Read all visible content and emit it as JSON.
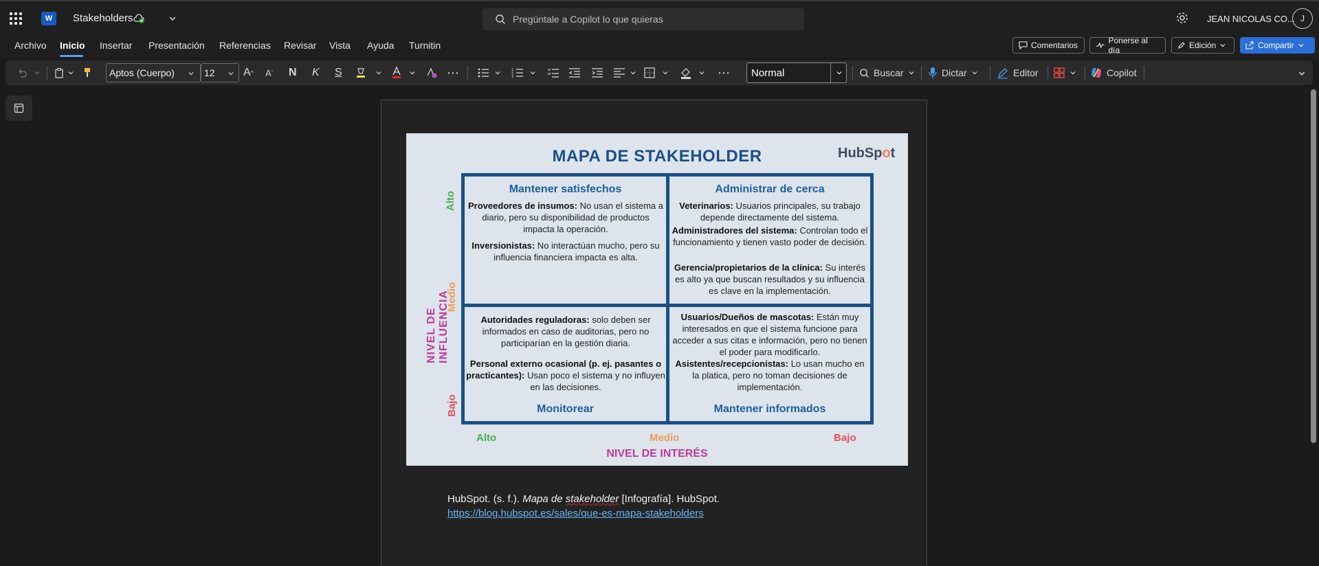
{
  "titlebar": {
    "doc_title": "Stakeholders",
    "search_placeholder": "Pregúntale a Copilot lo que quieras",
    "user_name": "JEAN NICOLAS CO...",
    "avatar_initial": "J",
    "app_badge": "W"
  },
  "menu": {
    "items": [
      "Archivo",
      "Inicio",
      "Insertar",
      "Presentación",
      "Referencias",
      "Revisar",
      "Vista",
      "Ayuda",
      "Turnitin"
    ],
    "active": "Inicio",
    "comments_label": "Comentarios",
    "catchup_label": "Ponerse al día",
    "editing_label": "Edición",
    "share_label": "Compartir"
  },
  "ribbon": {
    "font_name": "Aptos (Cuerpo)",
    "font_size": "12",
    "bold_glyph": "N",
    "italic_glyph": "K",
    "underline_glyph": "S",
    "style_name": "Normal",
    "find_label": "Buscar",
    "dictate_label": "Dictar",
    "editor_label": "Editor",
    "copilot_label": "Copilot"
  },
  "figure": {
    "title": "MAPA DE STAKEHOLDER",
    "brand": "HubSpot",
    "y_axis_label": "NIVEL DE INFLUENCIA",
    "x_axis_label": "NIVEL DE INTERÉS",
    "y_ticks": [
      "Alto",
      "Medio",
      "Bajo"
    ],
    "x_ticks": [
      "Alto",
      "Medio",
      "Bajo"
    ],
    "quadrants": {
      "top_left": {
        "heading": "Mantener satisfechos",
        "entries": [
          {
            "name": "Proveedores de insumos:",
            "text": " No usan el sistema a diario, pero su disponibilidad de productos impacta la operación."
          },
          {
            "name": "Inversionistas:",
            "text": " No interactúan mucho, pero su influencia financiera impacta es alta."
          }
        ]
      },
      "top_right": {
        "heading": "Administrar de cerca",
        "entries": [
          {
            "name": "Veterinarios:",
            "text": " Usuarios principales, su trabajo depende directamente del sistema."
          },
          {
            "name": "Administradores del sistema:",
            "text": " Controlan todo el funcionamiento y tienen vasto poder de decisión."
          },
          {
            "name": "Gerencia/propietarios de la clínica:",
            "text": " Su interés es alto ya que buscan resultados y su influencia es clave en la implementación."
          }
        ]
      },
      "bottom_left": {
        "heading": "Monitorear",
        "entries": [
          {
            "name": "Autoridades reguladoras:",
            "text": " solo deben ser informados en caso de auditorias, pero no participarían en la gestión diaria."
          },
          {
            "name": "Personal externo ocasional (p. ej. pasantes o practicantes):",
            "text": " Usan poco el sistema y no influyen en las decisiones."
          }
        ]
      },
      "bottom_right": {
        "heading": "Mantener informados",
        "entries": [
          {
            "name": "Usuarios/Dueños de mascotas:",
            "text": " Están muy interesados en que el sistema funcione para acceder a sus citas e información, pero no tienen el poder para modificarlo."
          },
          {
            "name": "Asistentes/recepcionistas:",
            "text": " Lo usan mucho en la platica, pero no toman decisiones de implementación."
          }
        ]
      }
    },
    "colors": {
      "navy": "#1c4f86",
      "magenta": "#c0399b",
      "green": "#4caf50",
      "orange": "#f29b57",
      "red": "#e8505b"
    }
  },
  "citation": {
    "prefix": "HubSpot. (s. f.). ",
    "title_part1": "Mapa de ",
    "title_part2": "stakeholder",
    "suffix": " [Infografía]. HubSpot.",
    "url": "https://blog.hubspot.es/sales/que-es-mapa-stakeholders"
  }
}
